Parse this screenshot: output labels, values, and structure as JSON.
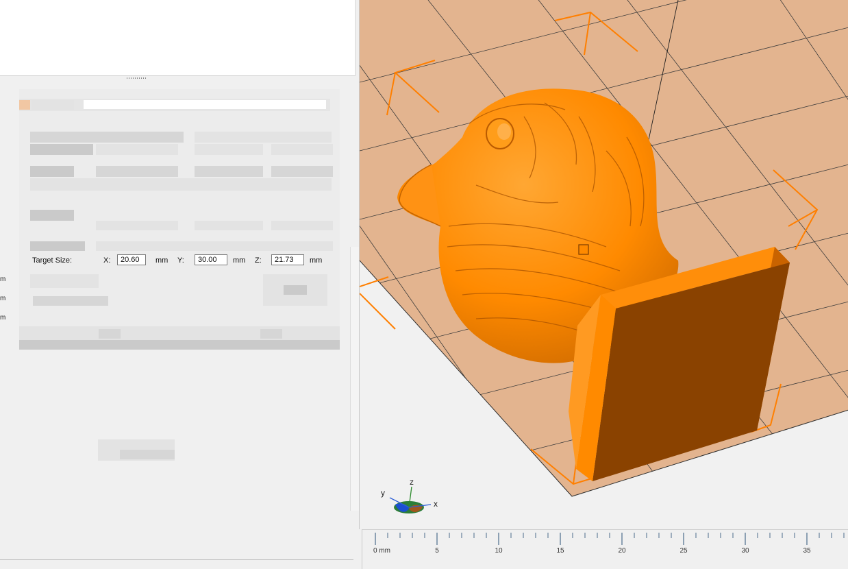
{
  "scale_dialog": {
    "target_size_label": "Target Size:",
    "x_label": "X:",
    "x_value": "20.60",
    "y_label": "Y:",
    "y_value": "30.00",
    "z_label": "Z:",
    "z_value": "21.73",
    "unit": "mm"
  },
  "left_units": [
    "m",
    "m",
    "m"
  ],
  "viewport": {
    "model_color": "#ff8a00",
    "bed_color": "#e3b48f",
    "axis_triad": {
      "x_label": "x",
      "y_label": "y",
      "z_label": "z"
    }
  },
  "ruler": {
    "tick_labels": [
      "0 mm",
      "5",
      "10",
      "15",
      "20",
      "25",
      "30",
      "35"
    ]
  }
}
